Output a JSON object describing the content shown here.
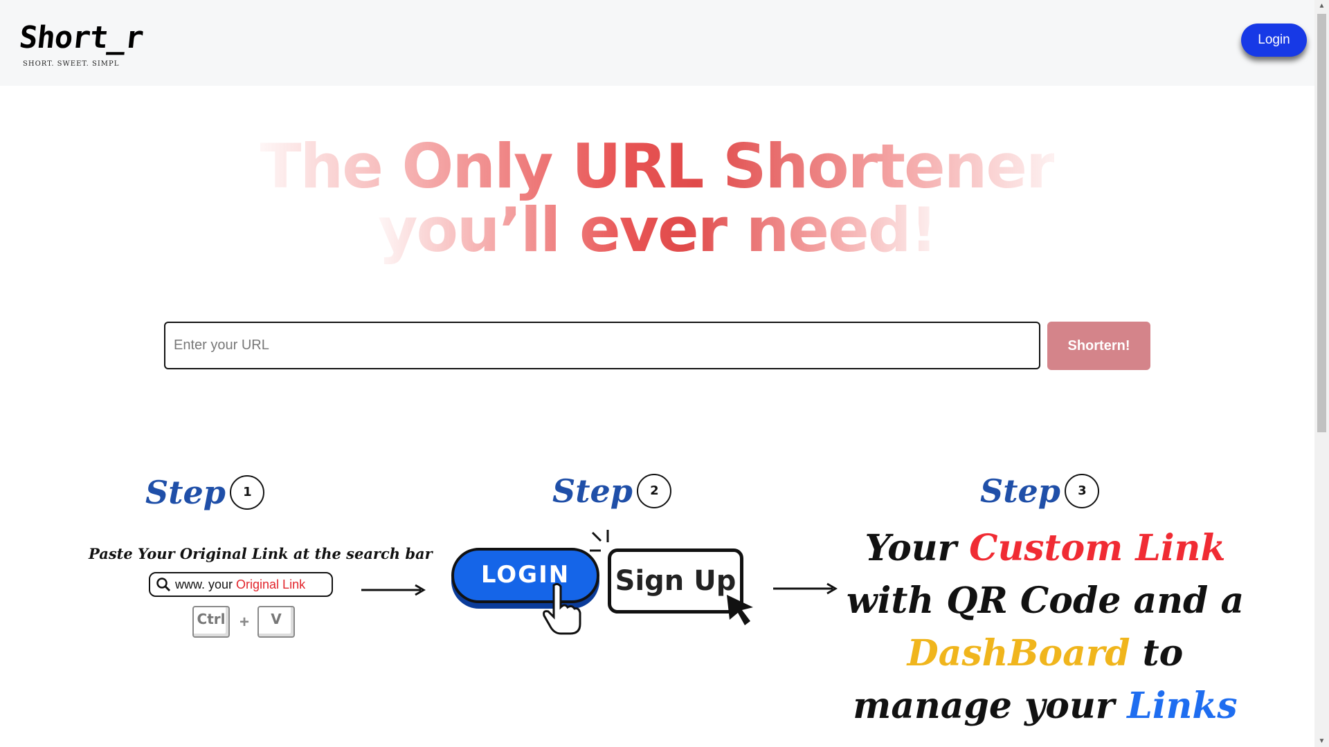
{
  "header": {
    "logo_text": "Short_r",
    "logo_tagline": "SHORT. SWEET. SIMPL",
    "login_label": "Login"
  },
  "hero": {
    "line1": "The Only URL Shortener",
    "line2": "you’ll ever need!"
  },
  "search": {
    "placeholder": "Enter your URL",
    "value": "",
    "button_label": "Shortern!"
  },
  "steps": [
    {
      "title": "Step",
      "number": "1",
      "instruction": "Paste Your Original Link at the search bar",
      "search_prefix": "www. your ",
      "search_highlight": "Original Link",
      "key1": "Ctrl",
      "plus": "+",
      "key2": "V"
    },
    {
      "title": "Step",
      "number": "2",
      "login_label": "LOGIN",
      "signup_label": "Sign Up"
    },
    {
      "title": "Step",
      "number": "3",
      "text_1": "Your ",
      "text_custom": "Custom Link",
      "text_2": "with QR Code and a",
      "text_dashboard": "DashBoard",
      "text_3": " to",
      "text_4": "manage your ",
      "text_links": "Links"
    }
  ],
  "colors": {
    "login_button": "#1739e6",
    "shorten_button": "#d4848a",
    "hero_text": "#e85555",
    "step_title": "#1f4fa8",
    "highlight_red": "#f02b33",
    "highlight_yellow": "#f0b51c",
    "highlight_blue": "#1e6df0"
  }
}
